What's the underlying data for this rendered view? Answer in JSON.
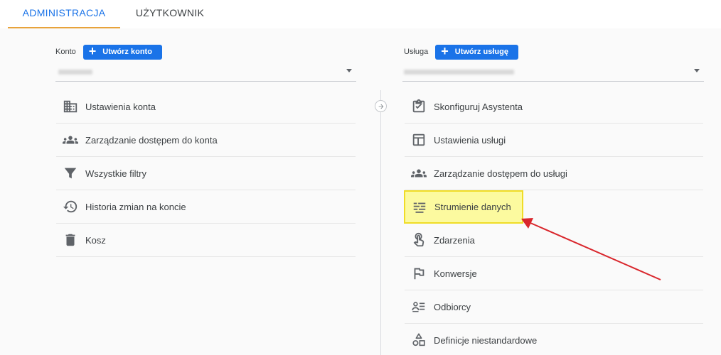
{
  "tabs": [
    {
      "label": "ADMINISTRACJA",
      "active": true
    },
    {
      "label": "UŻYTKOWNIK",
      "active": false
    }
  ],
  "account": {
    "label": "Konto",
    "create_button": "Utwórz konto",
    "menu": [
      {
        "label": "Ustawienia konta",
        "icon": "building-icon"
      },
      {
        "label": "Zarządzanie dostępem do konta",
        "icon": "people-icon"
      },
      {
        "label": "Wszystkie filtry",
        "icon": "filter-icon"
      },
      {
        "label": "Historia zmian na koncie",
        "icon": "history-icon"
      },
      {
        "label": "Kosz",
        "icon": "trash-icon"
      }
    ]
  },
  "property": {
    "label": "Usługa",
    "create_button": "Utwórz usługę",
    "menu": [
      {
        "label": "Skonfiguruj Asystenta",
        "icon": "clipboard-check-icon"
      },
      {
        "label": "Ustawienia usługi",
        "icon": "layout-icon"
      },
      {
        "label": "Zarządzanie dostępem do usługi",
        "icon": "people-icon"
      },
      {
        "label": "Strumienie danych",
        "icon": "data-streams-icon",
        "highlighted": true
      },
      {
        "label": "Zdarzenia",
        "icon": "touch-icon"
      },
      {
        "label": "Konwersje",
        "icon": "flag-icon"
      },
      {
        "label": "Odbiorcy",
        "icon": "audience-icon"
      },
      {
        "label": "Definicje niestandardowe",
        "icon": "shapes-icon"
      }
    ]
  },
  "colors": {
    "accent": "#1a73e8",
    "tab_underline": "#e8a33b",
    "highlight_fill": "#fcfa9f",
    "highlight_border": "#f0dc26",
    "annotation_arrow": "#d9262c"
  }
}
